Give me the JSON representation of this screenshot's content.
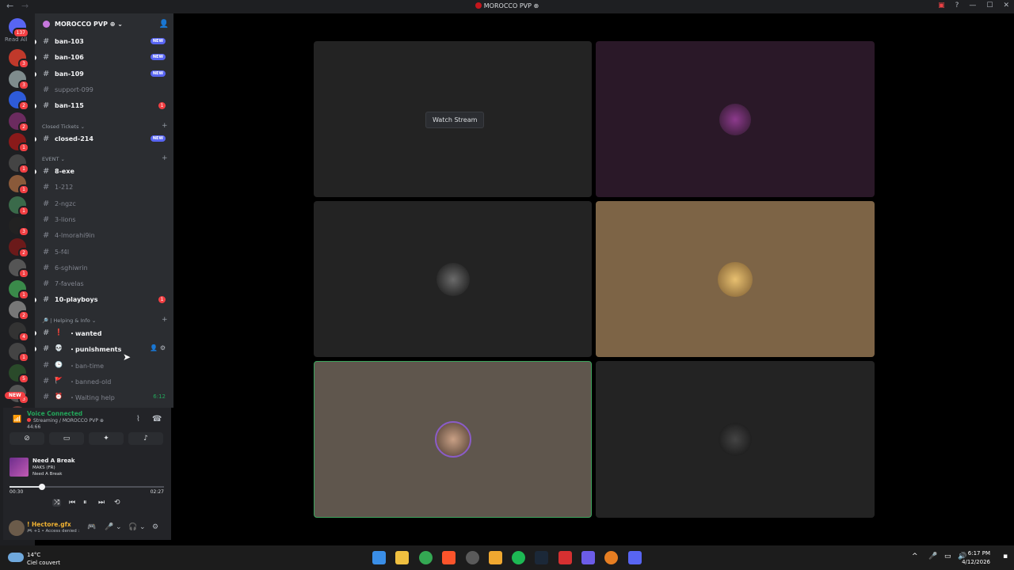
{
  "window": {
    "title": "MOROCCO PVP",
    "back": "←",
    "forward": "→"
  },
  "servers": {
    "badge_top": "137",
    "read_all": "Read All",
    "new_label": "NEW",
    "badges": [
      "3",
      "3",
      "2",
      "2",
      "1",
      "1",
      "1",
      "1",
      "3",
      "2",
      "1",
      "1",
      "2",
      "4",
      "1",
      "5",
      "3",
      "1"
    ]
  },
  "server_header": {
    "name": "MOROCCO PVP ⊕ ⌄"
  },
  "channels": [
    {
      "name": "ban-103",
      "bold": true,
      "tag": "NEW"
    },
    {
      "name": "ban-106",
      "bold": true,
      "tag": "NEW"
    },
    {
      "name": "ban-109",
      "bold": true,
      "tag": "NEW"
    },
    {
      "name": "support-099",
      "bold": false
    },
    {
      "name": "ban-115",
      "bold": true,
      "ping": "1"
    }
  ],
  "categories": {
    "closed": "Closed Tickets ⌄",
    "event": "EVENT ⌄",
    "helping": "🔎 | Helping & Info ⌄"
  },
  "closed_channels": [
    {
      "name": "closed-214",
      "bold": true,
      "tag": "NEW"
    }
  ],
  "event_channels": [
    {
      "name": "8-exe",
      "bold": true
    },
    {
      "name": "1-212"
    },
    {
      "name": "2-ngzc"
    },
    {
      "name": "3-lions"
    },
    {
      "name": "4-lmorahi9in"
    },
    {
      "name": "5-f4l"
    },
    {
      "name": "6-sghiwrin"
    },
    {
      "name": "7-favelas"
    },
    {
      "name": "10-playboys",
      "bold": true,
      "ping": "1"
    }
  ],
  "helping_channels": [
    {
      "name": "・wanted",
      "emoji": "❗",
      "bold": true
    },
    {
      "name": "・punishments",
      "emoji": "💀",
      "bold": true
    },
    {
      "name": "・ban-time",
      "emoji": "🕒"
    },
    {
      "name": "・banned-old",
      "emoji": "🚩"
    },
    {
      "name": "・Waiting help",
      "emoji": "⏰",
      "time": "6:12"
    }
  ],
  "voice": {
    "status": "Voice Connected",
    "sub": "Streaming / MOROCCO PVP ⊕",
    "elapsed": "44:66"
  },
  "music": {
    "title": "Need A Break",
    "artist": "MAKS (FR)",
    "album": "Need A Break",
    "elapsed": "00:30",
    "duration": "02:27",
    "progress": 0.21
  },
  "user": {
    "name": "! Hectore.gfx",
    "status": "🎮 +1 • Access denied :"
  },
  "stage": {
    "watch_label": "Watch Stream"
  },
  "taskbar": {
    "temp": "14°C",
    "weather": "Ciel couvert",
    "time": "6:17 PM",
    "date": "4/12/2026"
  }
}
